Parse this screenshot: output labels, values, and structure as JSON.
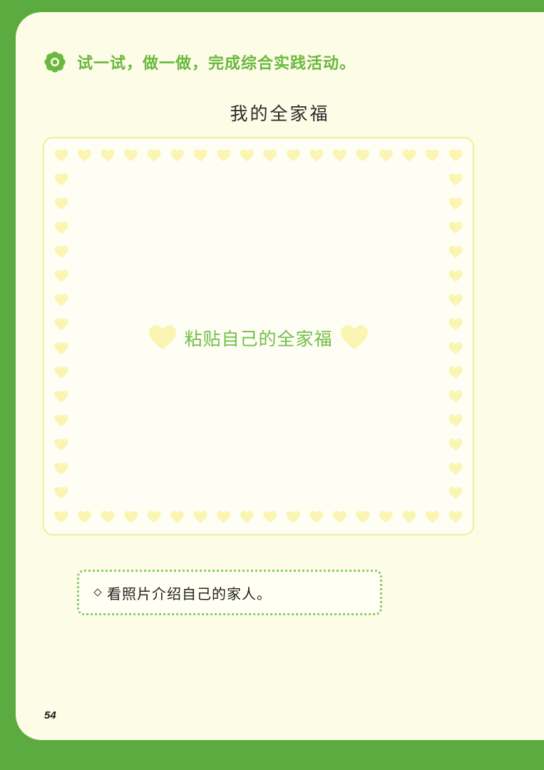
{
  "header": {
    "icon": "flower-icon",
    "instruction": "试一试，做一做，完成综合实践活动。"
  },
  "frame": {
    "title": "我的全家福",
    "paste_label": "粘贴自己的全家福",
    "heart_icon": "heart-icon"
  },
  "task": {
    "icon": "diamond-bullet-icon",
    "text": "看照片介绍自己的家人。"
  },
  "page_number": "54",
  "colors": {
    "page_green": "#5cab41",
    "text_green": "#6ab83f",
    "heart_yellow": "#fbf5b4",
    "paper": "#fdfce6"
  }
}
